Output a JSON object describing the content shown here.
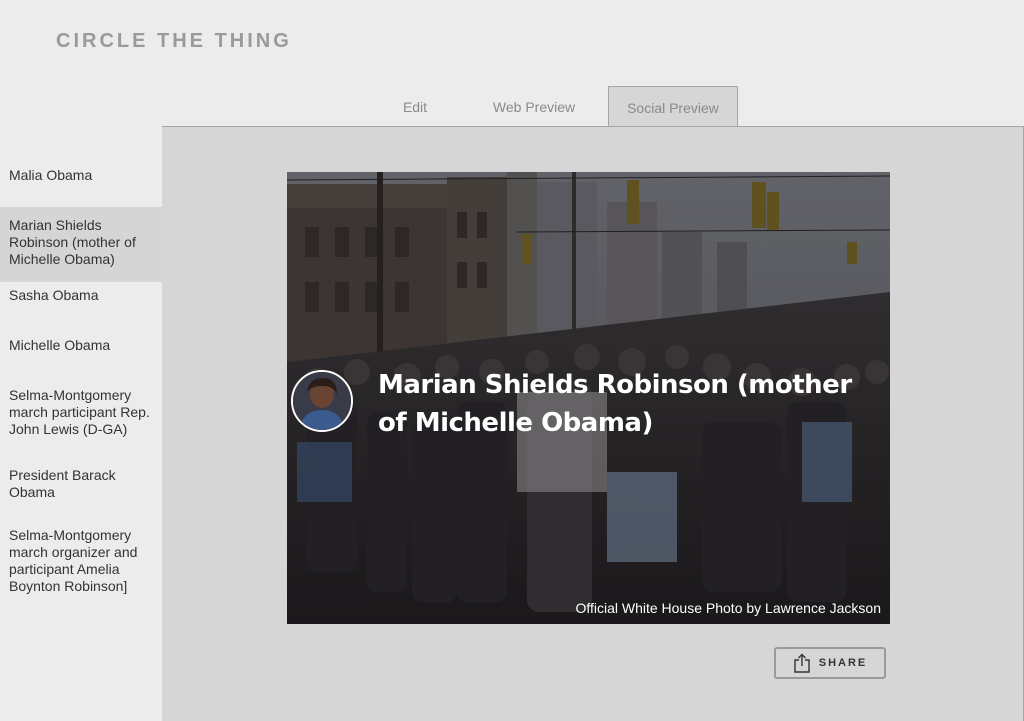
{
  "app": {
    "title": "CIRCLE THE THING"
  },
  "tabs": [
    {
      "label": "Edit"
    },
    {
      "label": "Web Preview"
    },
    {
      "label": "Social Preview"
    }
  ],
  "active_tab": "Social Preview",
  "sidebar": {
    "items": [
      {
        "label": "Malia Obama"
      },
      {
        "label": "Marian Shields Robinson (mother of Michelle Obama)"
      },
      {
        "label": "Sasha Obama"
      },
      {
        "label": "Michelle Obama"
      },
      {
        "label": "Selma-Montgomery march participant Rep. John Lewis (D-GA)"
      },
      {
        "label": "President Barack Obama"
      },
      {
        "label": "Selma-Montgomery march organizer and participant Amelia Boynton Robinson]"
      }
    ],
    "active_index": 1
  },
  "preview": {
    "headline": "Marian Shields Robinson (mother of Michelle Obama)",
    "credit": "Official White House Photo by Lawrence Jackson"
  },
  "share": {
    "label": "SHARE",
    "icon": "share-icon"
  },
  "colors": {
    "background": "#ececec",
    "panel": "#d6d6d6",
    "active_item": "#d5d5d5",
    "title": "#9a9a9a"
  }
}
